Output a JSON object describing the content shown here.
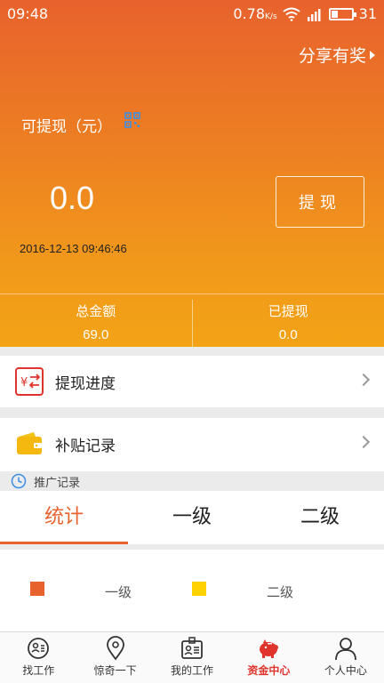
{
  "status_bar": {
    "time": "09:48",
    "net_speed": "0.78",
    "net_unit": "K/s",
    "battery": "31"
  },
  "header": {
    "share_label": "分享有奖",
    "available_label": "可提现（元）",
    "balance": "0.0",
    "withdraw_button": "提现",
    "datetime": "2016-12-13 09:46:46"
  },
  "summary": {
    "total_label": "总金额",
    "total_value": "69.0",
    "withdrawn_label": "已提现",
    "withdrawn_value": "0.0"
  },
  "menu": [
    {
      "label": "提现进度",
      "icon": "yuan-exchange-icon"
    },
    {
      "label": "补贴记录",
      "icon": "wallet-icon"
    }
  ],
  "promo_section": {
    "label": "推广记录",
    "icon": "clock-icon"
  },
  "tabs": [
    {
      "label": "统计",
      "active": true
    },
    {
      "label": "一级",
      "active": false
    },
    {
      "label": "二级",
      "active": false
    }
  ],
  "legend": [
    {
      "label": "一级",
      "color": "#e8622d"
    },
    {
      "label": "二级",
      "color": "#ffd200"
    }
  ],
  "bottom_nav": [
    {
      "label": "找工作",
      "icon": "search-job-icon"
    },
    {
      "label": "惊奇一下",
      "icon": "location-pin-icon"
    },
    {
      "label": "我的工作",
      "icon": "badge-icon"
    },
    {
      "label": "资金中心",
      "icon": "piggy-bank-icon",
      "active": true
    },
    {
      "label": "个人中心",
      "icon": "person-icon"
    }
  ],
  "colors": {
    "accent": "#e8622d",
    "active_nav": "#e0332b"
  }
}
